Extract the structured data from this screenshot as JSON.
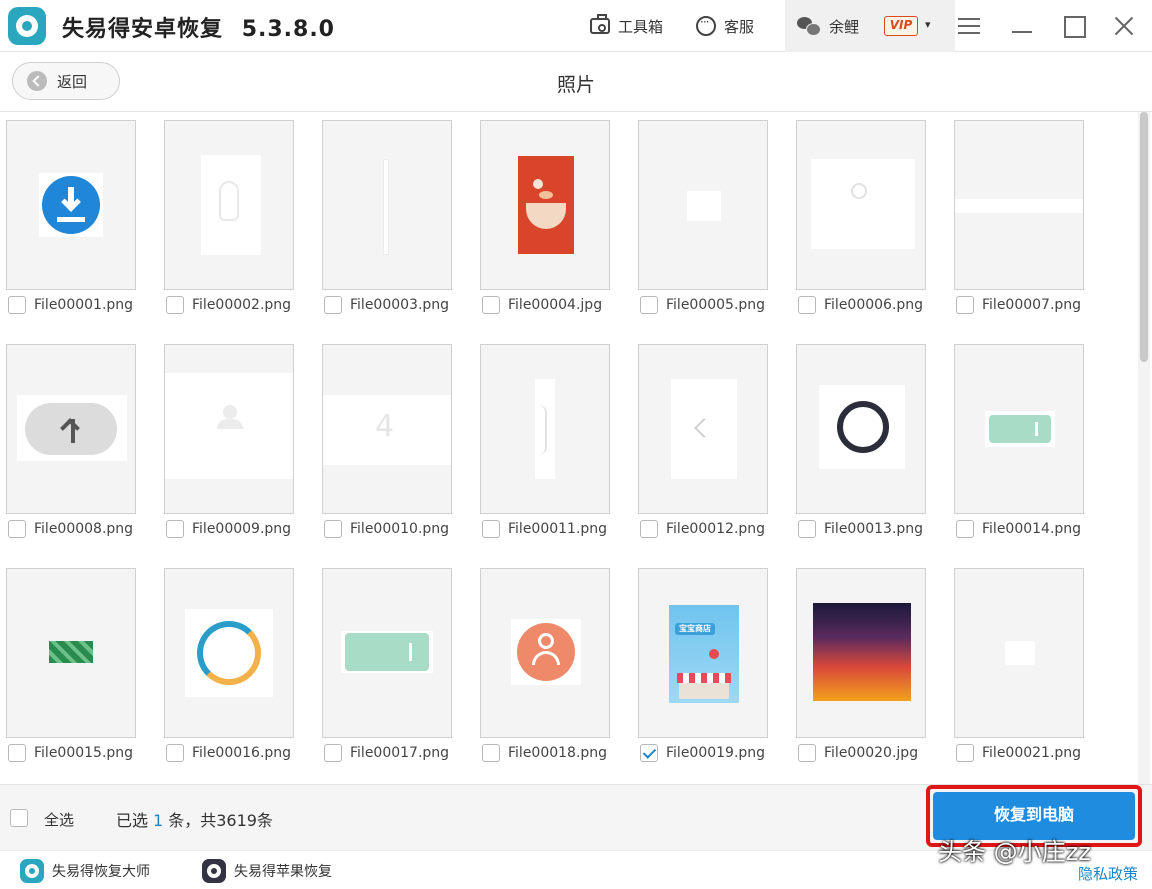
{
  "titlebar": {
    "app_name": "失易得安卓恢复",
    "version": "5.3.8.0",
    "toolbox_label": "工具箱",
    "service_label": "客服",
    "user_name": "余鲤",
    "vip_badge": "VIP",
    "caret": "▾"
  },
  "subheader": {
    "back_label": "返回",
    "page_title": "照片"
  },
  "files": [
    {
      "name": "File00001.png",
      "checked": false
    },
    {
      "name": "File00002.png",
      "checked": false
    },
    {
      "name": "File00003.png",
      "checked": false
    },
    {
      "name": "File00004.jpg",
      "checked": false
    },
    {
      "name": "File00005.png",
      "checked": false
    },
    {
      "name": "File00006.png",
      "checked": false
    },
    {
      "name": "File00007.png",
      "checked": false
    },
    {
      "name": "File00008.png",
      "checked": false
    },
    {
      "name": "File00009.png",
      "checked": false
    },
    {
      "name": "File00010.png",
      "checked": false
    },
    {
      "name": "File00011.png",
      "checked": false
    },
    {
      "name": "File00012.png",
      "checked": false
    },
    {
      "name": "File00013.png",
      "checked": false
    },
    {
      "name": "File00014.png",
      "checked": false
    },
    {
      "name": "File00015.png",
      "checked": false
    },
    {
      "name": "File00016.png",
      "checked": false
    },
    {
      "name": "File00017.png",
      "checked": false
    },
    {
      "name": "File00018.png",
      "checked": false
    },
    {
      "name": "File00019.png",
      "checked": true
    },
    {
      "name": "File00020.jpg",
      "checked": false
    },
    {
      "name": "File00021.png",
      "checked": false
    }
  ],
  "thumb_text": {
    "file10_digit": "4",
    "file19_banner": "宝宝商店"
  },
  "footer": {
    "select_all_label": "全选",
    "status_prefix": "已选",
    "selected_count": "1",
    "status_suffix": "条，共3619条",
    "recover_button": "恢复到电脑"
  },
  "bottombar": {
    "link1": "失易得恢复大师",
    "link2": "失易得苹果恢复",
    "privacy": "隐私政策"
  },
  "watermark": "头条 @小庄zz",
  "colors": {
    "accent": "#1f8ce0",
    "highlight_border": "#e01515",
    "brand": "#2aa6bf"
  }
}
